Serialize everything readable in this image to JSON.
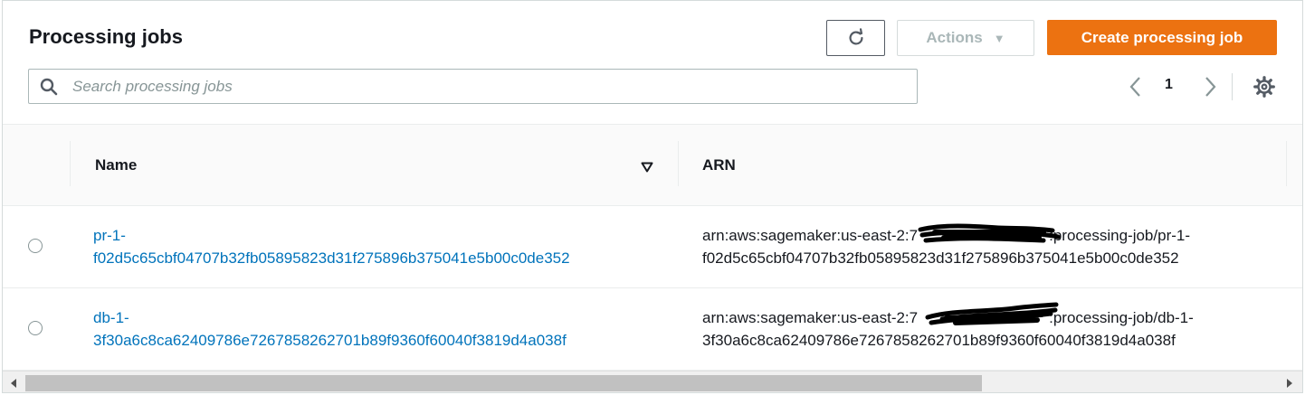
{
  "header": {
    "title": "Processing jobs",
    "actions_label": "Actions",
    "create_label": "Create processing job",
    "icons": {
      "refresh": "refresh-icon",
      "caret": "caret-down-icon",
      "settings": "gear-icon"
    }
  },
  "search": {
    "placeholder": "Search processing jobs",
    "value": ""
  },
  "pagination": {
    "current_page": "1"
  },
  "table": {
    "columns": [
      {
        "label": "Name"
      },
      {
        "label": "ARN"
      }
    ],
    "rows": [
      {
        "name_line1": "pr-1-",
        "name_line2": "f02d5c65cbf04707b32fb05895823d31f275896b375041e5b00c0de352",
        "arn_line1_prefix": "arn:aws:sagemaker:us-east-2:7",
        "arn_line1_suffix": ":processing-job/pr-1-",
        "arn_line2": "f02d5c65cbf04707b32fb05895823d31f275896b375041e5b00c0de352"
      },
      {
        "name_line1": "db-1-",
        "name_line2": "3f30a6c8ca62409786e7267858262701b89f9360f60040f3819d4a038f",
        "arn_line1_prefix": "arn:aws:sagemaker:us-east-2:7",
        "arn_line1_suffix": ":processing-job/db-1-",
        "arn_line2": "3f30a6c8ca62409786e7267858262701b89f9360f60040f3819d4a038f"
      }
    ]
  },
  "colors": {
    "accent": "#ec7211",
    "link": "#0073bb",
    "text": "#16191f",
    "muted": "#879596"
  }
}
